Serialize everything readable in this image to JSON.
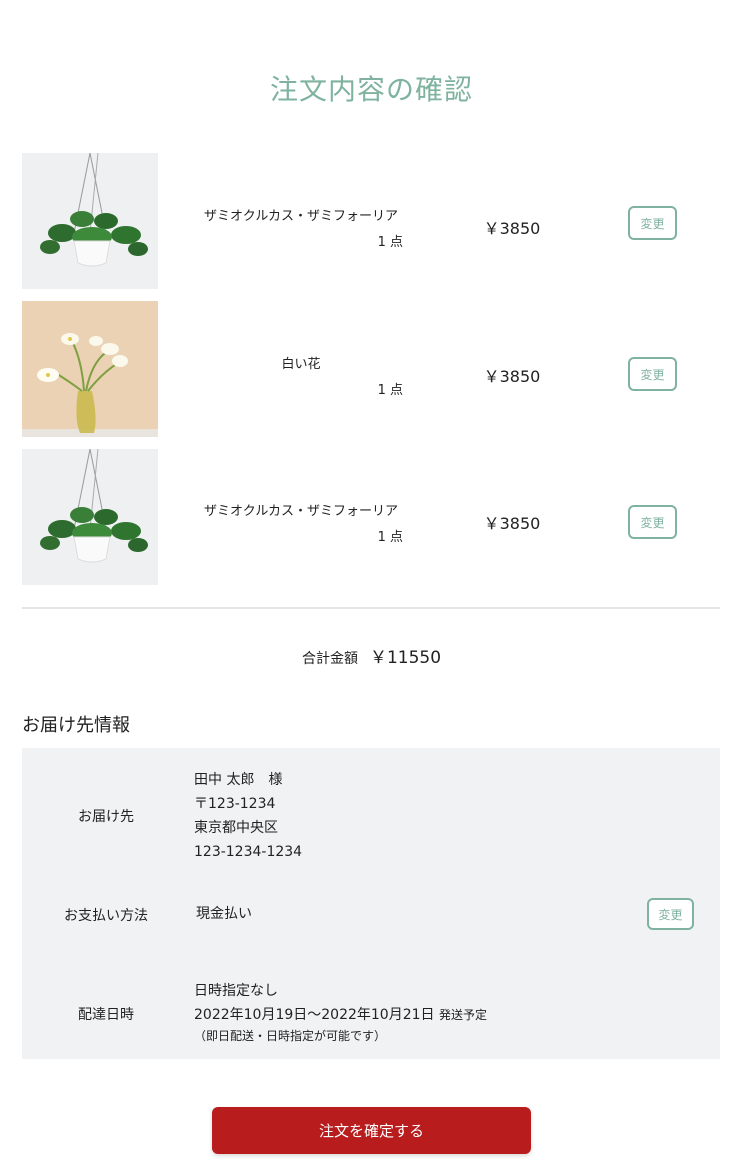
{
  "page": {
    "title": "注文内容の確認"
  },
  "items": [
    {
      "name": "ザミオクルカス・ザミフォーリア",
      "qty": "1 点",
      "price": "￥3850",
      "change_label": "変更",
      "image_icon": "hanging-plant-photo"
    },
    {
      "name": "白い花",
      "qty": "1 点",
      "price": "￥3850",
      "change_label": "変更",
      "image_icon": "white-flower-vase-photo"
    },
    {
      "name": "ザミオクルカス・ザミフォーリア",
      "qty": "1 点",
      "price": "￥3850",
      "change_label": "変更",
      "image_icon": "hanging-plant-photo"
    }
  ],
  "total": {
    "label": "合計金額",
    "value": "￥11550"
  },
  "delivery_info": {
    "heading": "お届け先情報",
    "recipient": {
      "label": "お届け先",
      "name": "田中 太郎　様",
      "postal": "〒123-1234",
      "address": "東京都中央区",
      "phone": "123-1234-1234"
    },
    "payment": {
      "label": "お支払い方法",
      "value": "現金払い",
      "change_label": "変更"
    },
    "schedule": {
      "label": "配達日時",
      "line1": "日時指定なし",
      "range": "2022年10月19日～2022年10月21日",
      "range_suffix": "発送予定",
      "note": "（即日配送・日時指定が可能です）"
    }
  },
  "confirm_button": {
    "label": "注文を確定する"
  },
  "colors": {
    "accent": "#7fb39f",
    "confirm": "#b81c1c",
    "info_bg": "#f1f2f4"
  }
}
